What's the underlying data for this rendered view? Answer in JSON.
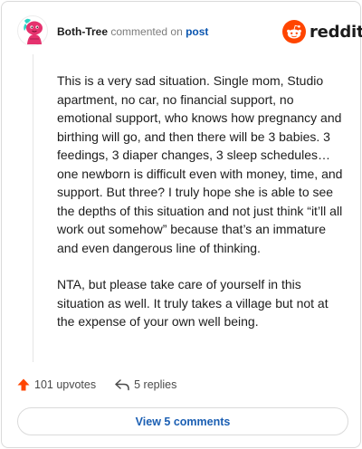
{
  "comment": {
    "author": "Both-Tree",
    "action_text": "commented on",
    "target_text": "post",
    "brand": "reddit",
    "paragraphs": [
      "This is a very sad situation. Single mom, Studio apartment, no car, no financial support, no emotional support, who knows how pregnancy and birthing will go, and then there will be 3 babies. 3 feedings, 3 diaper changes, 3 sleep schedules…one newborn is difficult even with money, time, and support. But three? I truly hope she is able to see the depths of this situation and not just think “it’ll all work out somehow” because that’s an immature and even dangerous line of thinking.",
      "NTA, but please take care of yourself in this situation as well. It truly takes a village but not at the expense of your own well being."
    ],
    "upvotes_label": "101 upvotes",
    "replies_label": "5 replies",
    "view_comments_label": "View 5 comments"
  },
  "colors": {
    "brand_orange": "#ff4500",
    "upvote_orange": "#ff4500",
    "link_blue": "#0b56b0",
    "avatar_pink": "#e5326e",
    "avatar_teal": "#2ed3c6"
  },
  "icons": {
    "avatar": "snoo-avatar",
    "logo": "reddit-logo-icon",
    "upvote": "upvote-arrow-icon",
    "reply": "reply-arrow-icon"
  }
}
